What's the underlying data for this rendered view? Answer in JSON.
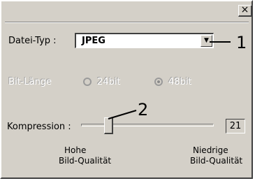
{
  "title_bar": {
    "close_label": "×"
  },
  "file_type": {
    "label": "Datei-Typ :",
    "value": "JPEG",
    "arrow": "▼"
  },
  "bit_depth": {
    "label": "Bit-Länge",
    "options": [
      {
        "label": "24bit",
        "selected": false
      },
      {
        "label": "48bit",
        "selected": true
      }
    ]
  },
  "compression": {
    "label": "Kompression :",
    "value": "21",
    "low_label_1": "Hohe",
    "low_label_2": "Bild-Qualität",
    "high_label_1": "Niedrige",
    "high_label_2": "Bild-Qualität"
  },
  "callouts": {
    "one": "1",
    "two": "2"
  }
}
